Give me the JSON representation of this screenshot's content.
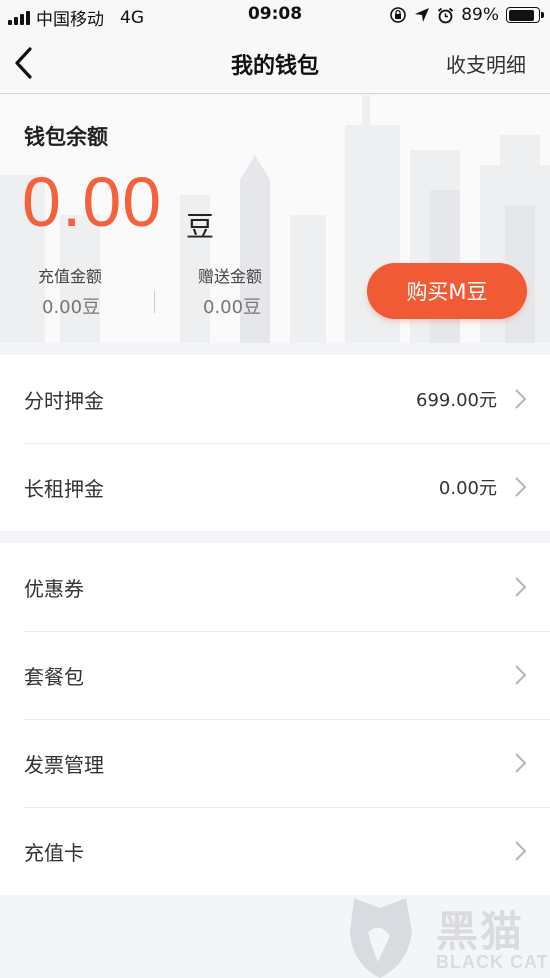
{
  "status_bar": {
    "carrier": "中国移动",
    "network": "4G",
    "time": "09:08",
    "battery_percent": "89%",
    "battery_level": 0.89,
    "icons": [
      "signal-icon",
      "rotation-lock-icon",
      "location-icon",
      "alarm-icon",
      "battery-icon"
    ]
  },
  "nav": {
    "title": "我的钱包",
    "action_label": "收支明细",
    "back_icon": "back-chevron-icon"
  },
  "wallet": {
    "label": "钱包余额",
    "balance": "0.00",
    "balance_unit": "豆",
    "recharge_label": "充值金额",
    "recharge_value": "0.00豆",
    "gift_label": "赠送金额",
    "gift_value": "0.00豆",
    "buy_button": "购买M豆",
    "accent_color": "#f05a34"
  },
  "deposits": [
    {
      "label": "分时押金",
      "value": "699.00元"
    },
    {
      "label": "长租押金",
      "value": "0.00元"
    }
  ],
  "menu": [
    {
      "label": "优惠券"
    },
    {
      "label": "套餐包"
    },
    {
      "label": "发票管理"
    },
    {
      "label": "充值卡"
    }
  ],
  "watermark": {
    "text": "黑猫",
    "sub": "BLACK CAT"
  }
}
